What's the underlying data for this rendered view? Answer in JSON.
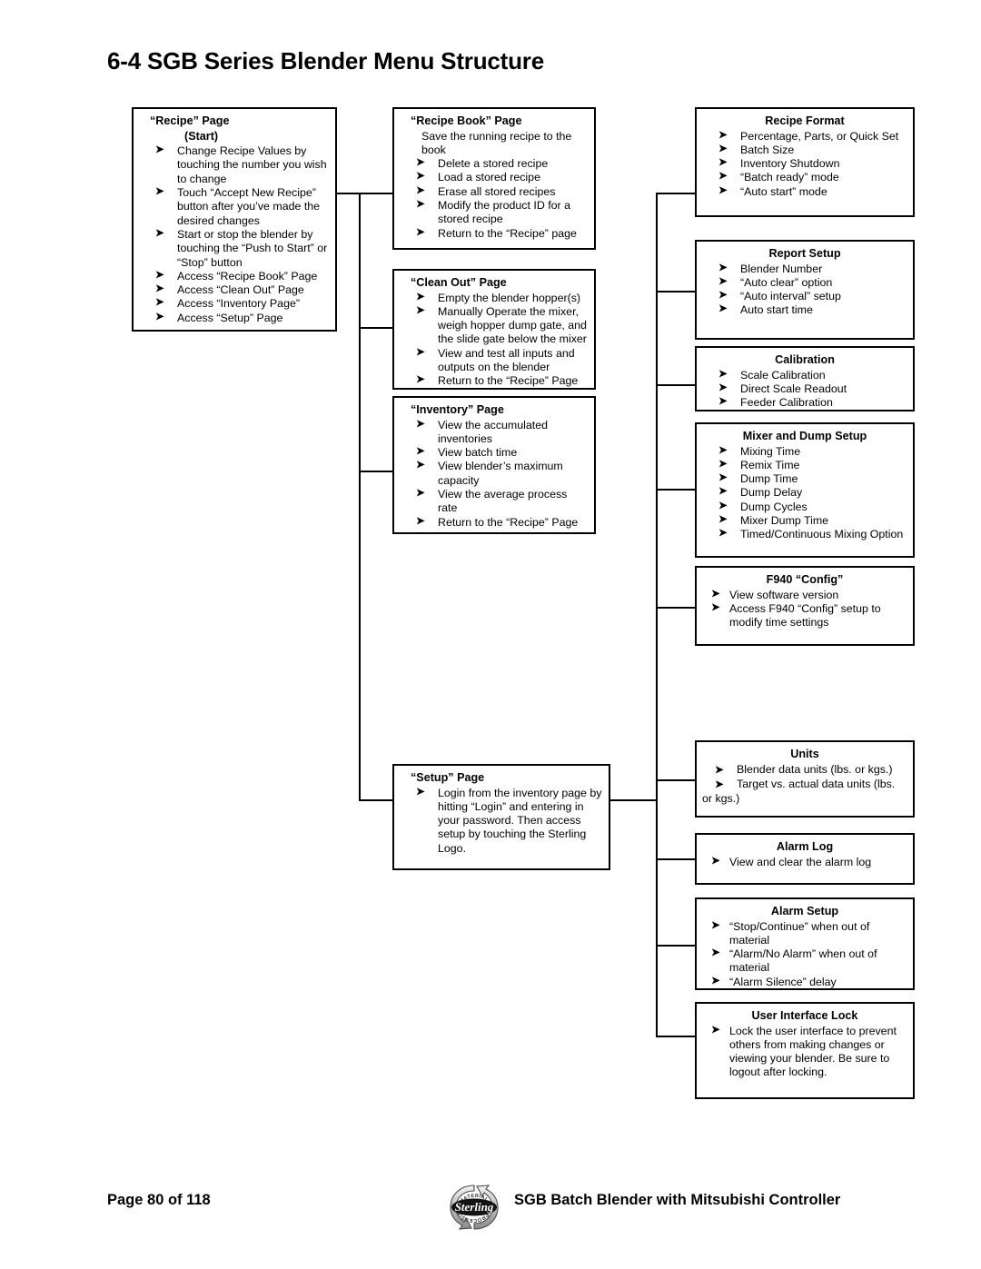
{
  "document": {
    "title": "6-4 SGB Series Blender Menu Structure",
    "arrow_glyph": "➤"
  },
  "footer": {
    "page_label": "Page 80 of 118",
    "caption": "SGB Batch Blender with Mitsubishi Controller",
    "logo": {
      "name": "sterling-logo",
      "word": "Sterling",
      "top_arc_text": "MATERIAL",
      "bottom_arc_text": "PROCESSING"
    }
  },
  "boxes": {
    "recipe_page": {
      "title": "“Recipe” Page",
      "subtitle": "(Start)",
      "items": [
        "Change Recipe Values by touching the number you wish to change",
        "Touch “Accept New Recipe” button after you’ve made the desired changes",
        "Start or stop the blender by touching the “Push to Start” or “Stop” button",
        "Access “Recipe Book” Page",
        "Access “Clean Out” Page",
        "Access “Inventory Page”",
        "Access “Setup” Page"
      ]
    },
    "recipe_book_page": {
      "title": "“Recipe Book” Page",
      "lead": "Save the running recipe to the book",
      "items": [
        "Delete a stored recipe",
        "Load a stored recipe",
        "Erase all stored recipes",
        "Modify the product ID for a stored recipe",
        "Return to the “Recipe” page"
      ]
    },
    "clean_out_page": {
      "title": "“Clean Out” Page",
      "items": [
        "Empty the blender hopper(s)",
        "Manually Operate the mixer, weigh hopper dump gate, and the slide gate below the mixer",
        "View and test all inputs and outputs on the blender",
        "Return to the “Recipe” Page"
      ]
    },
    "inventory_page": {
      "title": "“Inventory” Page",
      "items": [
        "View the accumulated inventories",
        "View batch time",
        "View blender’s maximum capacity",
        "View the average process rate",
        "Return to the “Recipe” Page"
      ]
    },
    "setup_page": {
      "title": "“Setup” Page",
      "items": [
        "Login from the inventory page by hitting “Login” and entering in your password.  Then access setup by touching the Sterling Logo."
      ]
    },
    "recipe_format": {
      "title": "Recipe Format",
      "items": [
        "Percentage, Parts, or Quick Set",
        "Batch Size",
        "Inventory Shutdown",
        "“Batch ready” mode",
        "“Auto start” mode"
      ]
    },
    "report_setup": {
      "title": "Report Setup",
      "items": [
        "Blender Number",
        "“Auto clear” option",
        "“Auto interval” setup",
        "Auto start time"
      ]
    },
    "calibration": {
      "title": "Calibration",
      "items": [
        "Scale Calibration",
        "Direct Scale Readout",
        "Feeder Calibration"
      ]
    },
    "mixer_and_dump_setup": {
      "title": "Mixer and Dump Setup",
      "items": [
        "Mixing Time",
        "Remix Time",
        "Dump Time",
        "Dump Delay",
        "Dump Cycles",
        "Mixer Dump Time",
        "Timed/Continuous Mixing Option"
      ]
    },
    "f940_config": {
      "title": "F940 “Config”",
      "items": [
        "View software version",
        "Access F940 “Config” setup to modify time settings"
      ]
    },
    "units": {
      "title": "Units",
      "items": [
        "Blender data units (lbs. or kgs.)",
        "Target vs. actual data units (lbs. or kgs.)"
      ]
    },
    "alarm_log": {
      "title": "Alarm Log",
      "items": [
        "View and clear the alarm log"
      ]
    },
    "alarm_setup": {
      "title": "Alarm Setup",
      "items": [
        "“Stop/Continue” when out of material",
        "“Alarm/No Alarm” when out of material",
        "“Alarm Silence” delay"
      ]
    },
    "user_interface_lock": {
      "title": "User Interface Lock",
      "items": [
        "Lock the user interface to prevent others from making changes or viewing your blender.  Be sure to logout after locking."
      ]
    }
  }
}
